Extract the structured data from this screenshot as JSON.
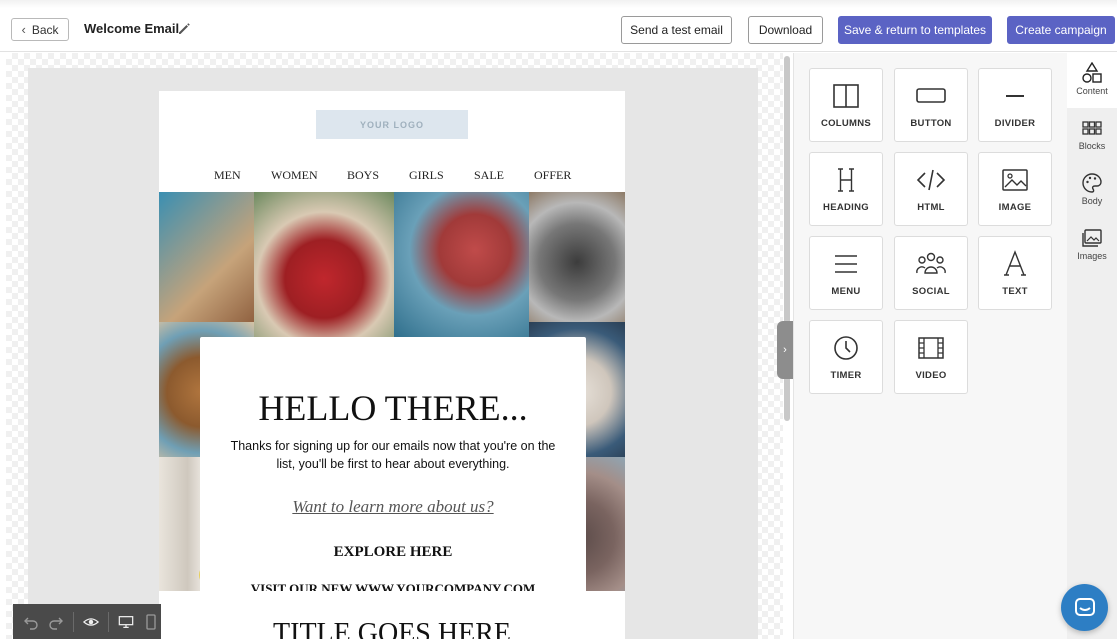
{
  "topbar": {
    "back_label": "Back",
    "title": "Welcome Email",
    "send_test_label": "Send a test email",
    "download_label": "Download",
    "save_return_label": "Save & return to templates",
    "create_campaign_label": "Create campaign"
  },
  "email": {
    "logo_text": "YOUR LOGO",
    "nav": [
      "MEN",
      "WOMEN",
      "BOYS",
      "GIRLS",
      "SALE",
      "OFFER"
    ],
    "hero": {
      "heading": "HELLO THERE...",
      "intro": "Thanks for signing up for our emails now that you're on the list, you'll be first to hear about everything.",
      "learn_more": "Want to learn more about us?",
      "explore": "EXPLORE HERE",
      "visit": "VISIT OUR NEW WWW.YOURCOMPANY.COM"
    },
    "section_title": "TITLE GOES HERE"
  },
  "panel": {
    "tools": [
      {
        "label": "COLUMNS",
        "icon": "columns-icon"
      },
      {
        "label": "BUTTON",
        "icon": "button-icon"
      },
      {
        "label": "DIVIDER",
        "icon": "divider-icon"
      },
      {
        "label": "HEADING",
        "icon": "heading-icon"
      },
      {
        "label": "HTML",
        "icon": "code-icon"
      },
      {
        "label": "IMAGE",
        "icon": "image-icon"
      },
      {
        "label": "MENU",
        "icon": "menu-icon"
      },
      {
        "label": "SOCIAL",
        "icon": "social-icon"
      },
      {
        "label": "TEXT",
        "icon": "text-icon"
      },
      {
        "label": "TIMER",
        "icon": "clock-icon"
      },
      {
        "label": "VIDEO",
        "icon": "video-icon"
      }
    ]
  },
  "side_tabs": [
    {
      "label": "Content",
      "icon": "shapes-icon",
      "active": true
    },
    {
      "label": "Blocks",
      "icon": "grid-icon",
      "active": false
    },
    {
      "label": "Body",
      "icon": "palette-icon",
      "active": false
    },
    {
      "label": "Images",
      "icon": "images-icon",
      "active": false
    }
  ],
  "colors": {
    "primary": "#5b63c4",
    "chat": "#2d7ec4",
    "toolbar": "#4a4a4a"
  }
}
